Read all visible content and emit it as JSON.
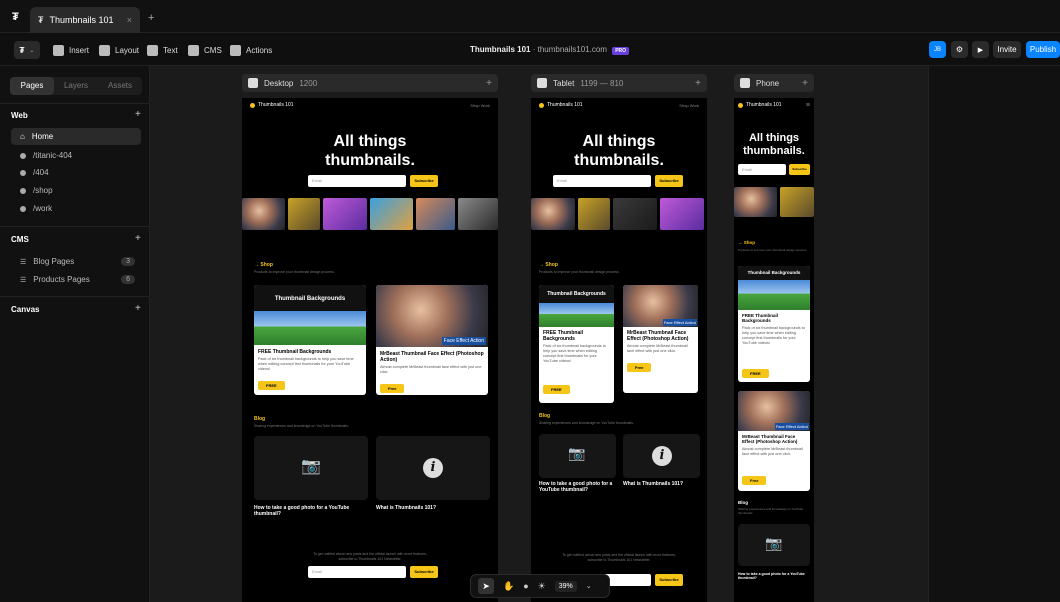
{
  "window": {
    "tab_title": "Thumbnails 101",
    "tab_close": "×",
    "new_tab": "+"
  },
  "toolbar": {
    "menu_icon": "framer-logo-icon",
    "insert": "Insert",
    "layout": "Layout",
    "text": "Text",
    "cms": "CMS",
    "actions": "Actions",
    "site_title": "Thumbnails 101",
    "site_domain": "· thumbnails101.com",
    "plan_badge": "PRO",
    "avatar": "JB",
    "invite": "Invite",
    "publish": "Publish",
    "publish_color": "#0a84ff"
  },
  "sidebar": {
    "tabs": [
      "Pages",
      "Layers",
      "Assets"
    ],
    "active_tab": "Pages",
    "web_section": "Web",
    "pages": [
      {
        "label": "Home",
        "selected": true
      },
      {
        "label": "/titanic-404"
      },
      {
        "label": "/404"
      },
      {
        "label": "/shop"
      },
      {
        "label": "/work"
      }
    ],
    "cms_section": "CMS",
    "cms_items": [
      {
        "label": "Blog Pages",
        "count": "3"
      },
      {
        "label": "Products Pages",
        "count": "6"
      }
    ],
    "canvas_section": "Canvas",
    "add": "+"
  },
  "breakpoints": {
    "desktop": {
      "label": "Desktop",
      "size": "1200"
    },
    "tablet": {
      "label": "Tablet",
      "size": "1199 — 810"
    },
    "phone": {
      "label": "Phone"
    }
  },
  "site": {
    "logo": "Thumbnails 101",
    "nav": "Shop   Work",
    "hero_line1": "All things",
    "hero_line2": "thumbnails.",
    "email_placeholder": "Email",
    "subscribe": "Subscribe",
    "shop_heading": "→ Shop",
    "shop_sub": "Products to improve your thumbnail design process.",
    "card1_header": "Thumbnail Backgrounds",
    "card1_title": "FREE Thumbnail Backgrounds",
    "card1_desc": "Pack of six thumbnail backgrounds to help you save time when editing concept first thumbnails for your YouTube videos!",
    "card1_btn": "FREE",
    "card2_badge": "Face Effect Action",
    "card2_title": "MrBeast Thumbnail Face Effect (Photoshop Action)",
    "card2_desc": "Almost complete MrBeast thumbnail face effect with just one click.",
    "card2_btn": "Free",
    "blog_heading": "Blog",
    "blog_sub": "Sharing experiences and knowledge on YouTube thumbnails.",
    "post1": "How to take a good photo for a YouTube thumbnail?",
    "post2": "What is Thumbnails 101?",
    "newsletter": "To get notified about new posts and the official launch with more features, subscribe to Thumbnails 101 Newsletter."
  },
  "floatbar": {
    "zoom": "39%"
  }
}
